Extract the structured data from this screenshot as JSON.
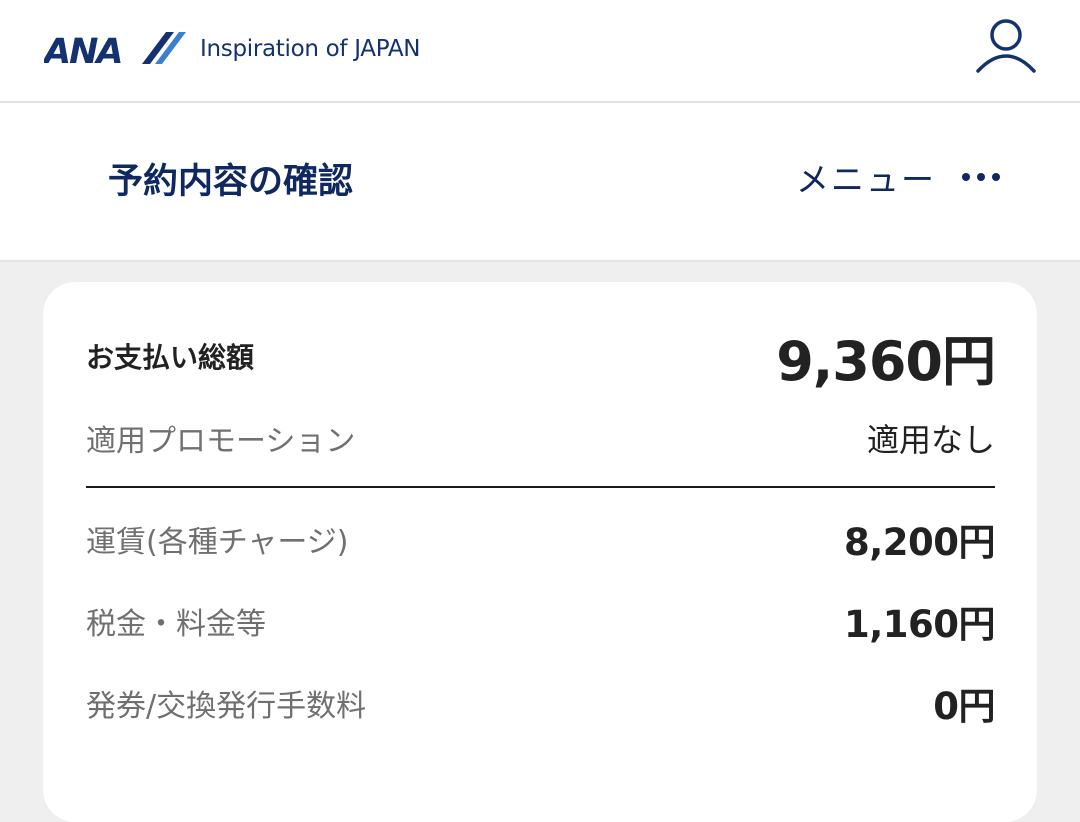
{
  "header": {
    "logo_text": "ANA",
    "tagline": "Inspiration of JAPAN",
    "account_icon": "user-icon",
    "brand_color": "#13326f"
  },
  "titlebar": {
    "title": "予約内容の確認",
    "menu_label": "メニュー",
    "menu_icon": "more-horizontal-icon"
  },
  "summary": {
    "total_label": "お支払い総額",
    "total_value": "9,360円",
    "promotion_label": "適用プロモーション",
    "promotion_value": "適用なし",
    "items": [
      {
        "label": "運賃(各種チャージ)",
        "value": "8,200円"
      },
      {
        "label": "税金・料金等",
        "value": "1,160円"
      },
      {
        "label": "発券/交換発行手数料",
        "value": "0円"
      }
    ]
  }
}
